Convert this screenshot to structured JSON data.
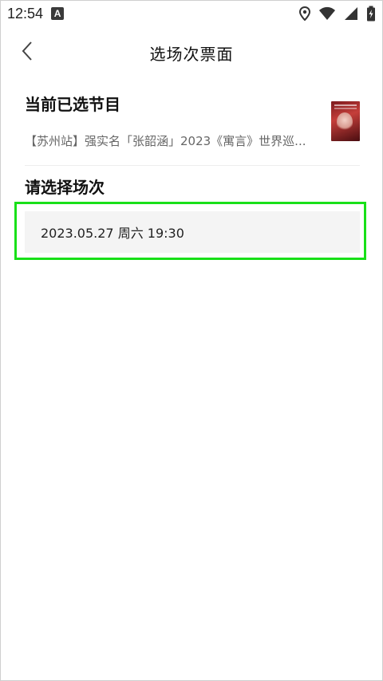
{
  "status_bar": {
    "time": "12:54",
    "notification_icon": "A",
    "icons": [
      "location-icon",
      "wifi-icon",
      "signal-icon",
      "battery-charging-icon"
    ]
  },
  "header": {
    "title": "选场次票面",
    "back_icon": "chevron-left-icon"
  },
  "selected_program": {
    "heading": "当前已选节目",
    "program_name": "【苏州站】强实名「张韶涵」2023《寓言》世界巡...",
    "poster_icon": "poster-thumbnail"
  },
  "choose_session": {
    "heading": "请选择场次",
    "sessions": [
      {
        "label": "2023.05.27 周六 19:30",
        "highlighted": true
      }
    ]
  },
  "colors": {
    "highlight_outline": "#19e019",
    "session_bg": "#f4f4f4",
    "text_primary": "#111111",
    "text_secondary": "#666666"
  }
}
